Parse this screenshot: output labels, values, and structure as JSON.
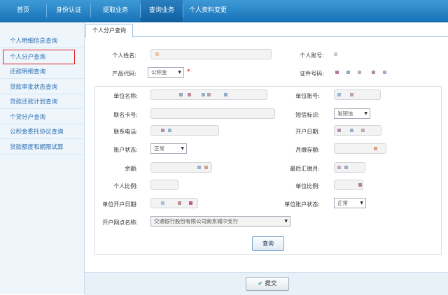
{
  "topnav": {
    "items": [
      {
        "label": "首页"
      },
      {
        "label": "身份认证"
      },
      {
        "label": "提取业务"
      },
      {
        "label": "查询业务"
      },
      {
        "label": "个人资料变更"
      }
    ]
  },
  "sidebar": {
    "items": [
      {
        "label": "个人明细信息查询"
      },
      {
        "label": "个人分户查询"
      },
      {
        "label": "还款明细查询"
      },
      {
        "label": "贷款审批状态查询"
      },
      {
        "label": "贷款还款计划查询"
      },
      {
        "label": "个贷分户查询"
      },
      {
        "label": "公积金委托协议查询"
      },
      {
        "label": "贷款额度和期限试算"
      }
    ]
  },
  "tab": {
    "label": "个人分户查询"
  },
  "form": {
    "name_label": "个人姓名:",
    "account_label": "个人账号:",
    "product_label": "产品代码:",
    "product_value": "公积金",
    "idcard_label": "证件号码:",
    "unit_name_label": "单位名称:",
    "unit_account_label": "单位账号:",
    "link_card_label": "联名卡号:",
    "sms_label": "短信标识:",
    "sms_value": "发短信",
    "phone_label": "联系电话:",
    "open_date_label": "开户日期:",
    "acct_status_label": "账户状态:",
    "acct_status_value": "正常",
    "monthly_label": "月缴存额:",
    "balance_label": "余额:",
    "last_month_label": "最后汇缴月:",
    "personal_ratio_label": "个人比例:",
    "unit_ratio_label": "单位比例:",
    "unit_open_date_label": "单位开户日期:",
    "unit_status_label": "单位账户状态:",
    "unit_status_value": "正常",
    "branch_label": "开户网点名称:",
    "branch_value": "交通银行股份有限公司南京城中支行",
    "required_mark": "*"
  },
  "buttons": {
    "query": "查询",
    "submit": "提交",
    "submit_icon": "✔"
  },
  "colors": {
    "nav_blue": "#1873b8",
    "link_blue": "#2c6fb0",
    "highlight_red": "#e02020"
  }
}
